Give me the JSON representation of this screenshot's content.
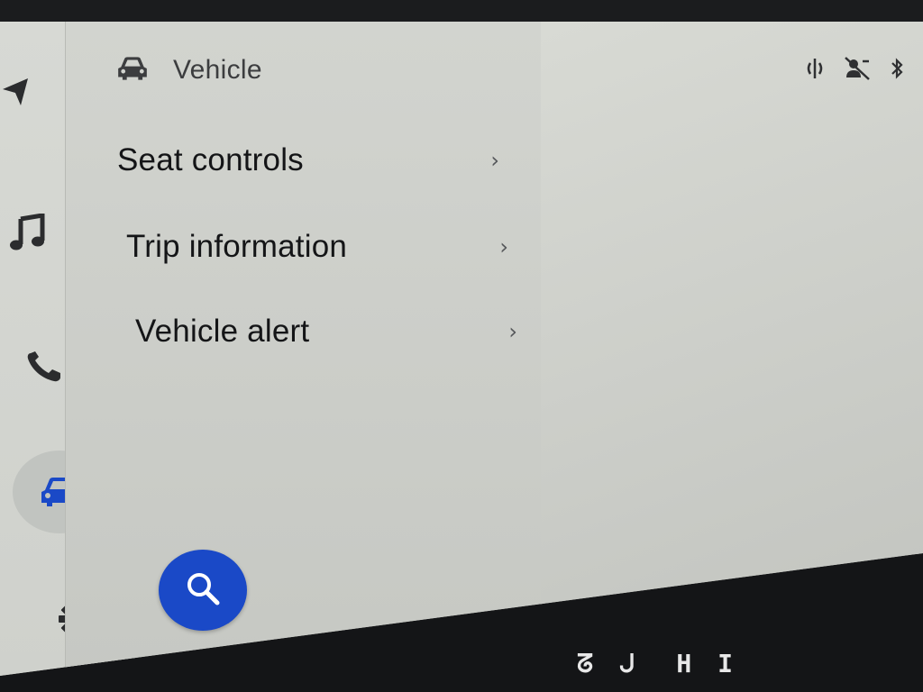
{
  "rail": {
    "items": [
      {
        "name": "navigation",
        "icon": "navigation-arrow-icon",
        "active": false
      },
      {
        "name": "music",
        "icon": "music-note-icon",
        "active": false
      },
      {
        "name": "phone",
        "icon": "phone-icon",
        "active": false
      },
      {
        "name": "vehicle",
        "icon": "car-icon",
        "active": true
      },
      {
        "name": "settings",
        "icon": "gear-icon",
        "active": false
      }
    ],
    "active_color": "#1a49c7"
  },
  "panel": {
    "icon": "car-icon",
    "title": "Vehicle",
    "items": [
      {
        "label": "Seat controls"
      },
      {
        "label": "Trip information"
      },
      {
        "label": "Vehicle alert"
      }
    ],
    "search_icon": "search-icon"
  },
  "status_bar": {
    "icons": [
      "wireless-charging-icon",
      "voice-assistant-off-icon",
      "bluetooth-icon"
    ]
  },
  "dashboard": {
    "readout_left": "ᘔ ᒍ",
    "readout_right": "H I"
  }
}
